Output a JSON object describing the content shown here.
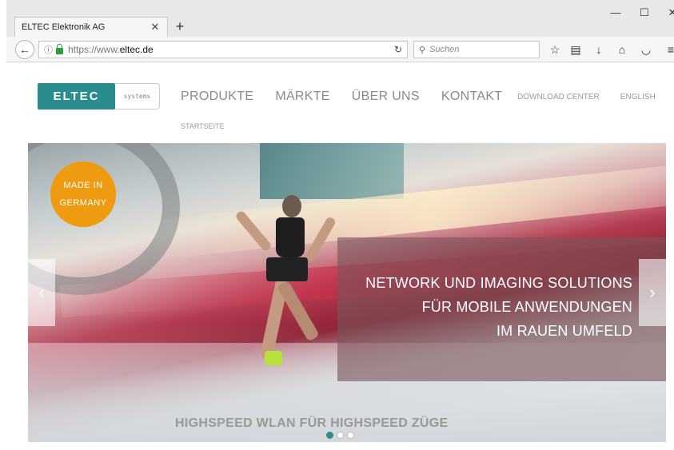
{
  "browser": {
    "tab_title": "ELTEC Elektronik AG",
    "tab_close": "✕",
    "new_tab": "+",
    "url_protocol": "https://www.",
    "url_host": "eltec.de",
    "search_placeholder": "Suchen",
    "window_buttons": {
      "minimize": "—",
      "maximize": "☐",
      "close": "✕"
    }
  },
  "header": {
    "logo_text": "ELTEC",
    "logo_sub": "systems",
    "nav": [
      "PRODUKTE",
      "MÄRKTE",
      "ÜBER UNS",
      "KONTAKT"
    ],
    "subnav": [
      "DOWNLOAD CENTER",
      "ENGLISH"
    ],
    "breadcrumb": "STARTSEITE"
  },
  "hero": {
    "badge_line1": "MADE IN",
    "badge_line2": "GERMANY",
    "headline": [
      "NETWORK UND IMAGING SOLUTIONS",
      "FÜR MOBILE ANWENDUNGEN",
      "IM RAUEN UMFELD"
    ],
    "caption": "HIGHSPEED WLAN FÜR HIGHSPEED ZÜGE",
    "arrow_prev": "‹",
    "arrow_next": "›",
    "slide_count": 3,
    "active_slide": 1
  },
  "colors": {
    "brand": "#2a8c8c",
    "badge": "#ee9b12"
  }
}
